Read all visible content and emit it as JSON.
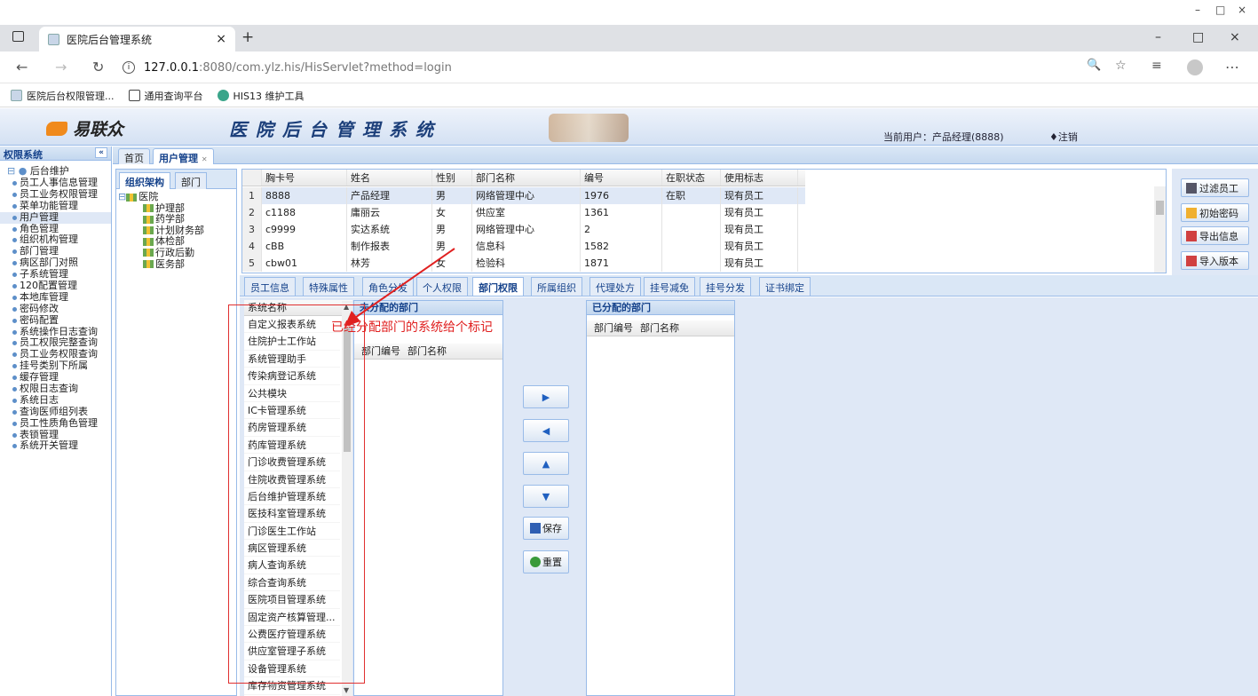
{
  "window": {
    "minimize": "–",
    "maximize": "□",
    "close": "×"
  },
  "browser": {
    "tab_title": "医院后台管理系统",
    "tab_close": "×",
    "new_tab": "+",
    "url_host": "127.0.0.1",
    "url_path": ":8080/com.ylz.his/HisServlet?method=login",
    "bookmarks": [
      {
        "label": "医院后台权限管理..."
      },
      {
        "label": "通用查询平台"
      },
      {
        "label": "HIS13 维护工具"
      }
    ]
  },
  "app": {
    "logo_text": "易联众",
    "system_name": "医院后台管理系统",
    "current_user": "当前用户：产品经理(8888)",
    "logout": "♦注销"
  },
  "left_panel": {
    "title": "权限系统",
    "collapse": "«",
    "root": "后台维护",
    "items": [
      "员工人事信息管理",
      "员工业务权限管理",
      "菜单功能管理",
      "用户管理",
      "角色管理",
      "组织机构管理",
      "部门管理",
      "病区部门对照",
      "子系统管理",
      "120配置管理",
      "本地库管理",
      "密码修改",
      "密码配置",
      "系统操作日志查询",
      "员工权限完整查询",
      "员工业务权限查询",
      "挂号类别下所属",
      "缓存管理",
      "权限日志查询",
      "系统日志",
      "查询医师组列表",
      "员工性质角色管理",
      "表锁管理",
      "系统开关管理"
    ]
  },
  "main_tabs": [
    {
      "label": "首页"
    },
    {
      "label": "用户管理"
    }
  ],
  "org_panel": {
    "tabs": [
      "组织架构",
      "部门"
    ],
    "root": "医院",
    "children": [
      "护理部",
      "药学部",
      "计划财务部",
      "体检部",
      "行政后勤",
      "医务部"
    ]
  },
  "employee_grid": {
    "columns": [
      "胸卡号",
      "姓名",
      "性别",
      "部门名称",
      "编号",
      "在职状态",
      "使用标志"
    ],
    "rows": [
      {
        "n": "1",
        "card": "8888",
        "name": "产品经理",
        "sex": "男",
        "dept": "网络管理中心",
        "no": "1976",
        "status": "在职",
        "flag": "现有员工"
      },
      {
        "n": "2",
        "card": "c1188",
        "name": "庸丽云",
        "sex": "女",
        "dept": "供应室",
        "no": "1361",
        "status": "",
        "flag": "现有员工"
      },
      {
        "n": "3",
        "card": "c9999",
        "name": "实达系统",
        "sex": "男",
        "dept": "网络管理中心",
        "no": "2",
        "status": "",
        "flag": "现有员工"
      },
      {
        "n": "4",
        "card": "cBB",
        "name": "制作报表",
        "sex": "男",
        "dept": "信息科",
        "no": "1582",
        "status": "",
        "flag": "现有员工"
      },
      {
        "n": "5",
        "card": "cbw01",
        "name": "林芳",
        "sex": "女",
        "dept": "检验科",
        "no": "1871",
        "status": "",
        "flag": "现有员工"
      }
    ]
  },
  "right_buttons": [
    "过滤员工",
    "初始密码",
    "导出信息",
    "导入版本"
  ],
  "sub_tabs": [
    "员工信息",
    "特殊属性",
    "角色分发",
    "个人权限",
    "部门权限",
    "所属组织",
    "代理处方",
    "挂号减免",
    "挂号分发",
    "证书绑定"
  ],
  "systems": {
    "header": "系统名称",
    "items": [
      "自定义报表系统",
      "住院护士工作站",
      "系统管理助手",
      "传染病登记系统",
      "公共模块",
      "IC卡管理系统",
      "药房管理系统",
      "药库管理系统",
      "门诊收费管理系统",
      "住院收费管理系统",
      "后台维护管理系统",
      "医技科室管理系统",
      "门诊医生工作站",
      "病区管理系统",
      "病人查询系统",
      "综合查询系统",
      "医院项目管理系统",
      "固定资产核算管理...",
      "公费医疗管理系统",
      "供应室管理子系统",
      "设备管理系统",
      "库存物资管理系统"
    ]
  },
  "unassigned": {
    "title": "未分配的部门",
    "col_no": "部门编号",
    "col_name": "部门名称"
  },
  "assigned": {
    "title": "已分配的部门",
    "col_no": "部门编号",
    "col_name": "部门名称"
  },
  "middle_buttons": {
    "save": "保存",
    "reset": "重置",
    "right": "▶",
    "left": "◀",
    "up": "▲",
    "down": "▼"
  },
  "annotation": {
    "text": "已经分配部门的系统给个标记",
    "color": "#e02020"
  }
}
